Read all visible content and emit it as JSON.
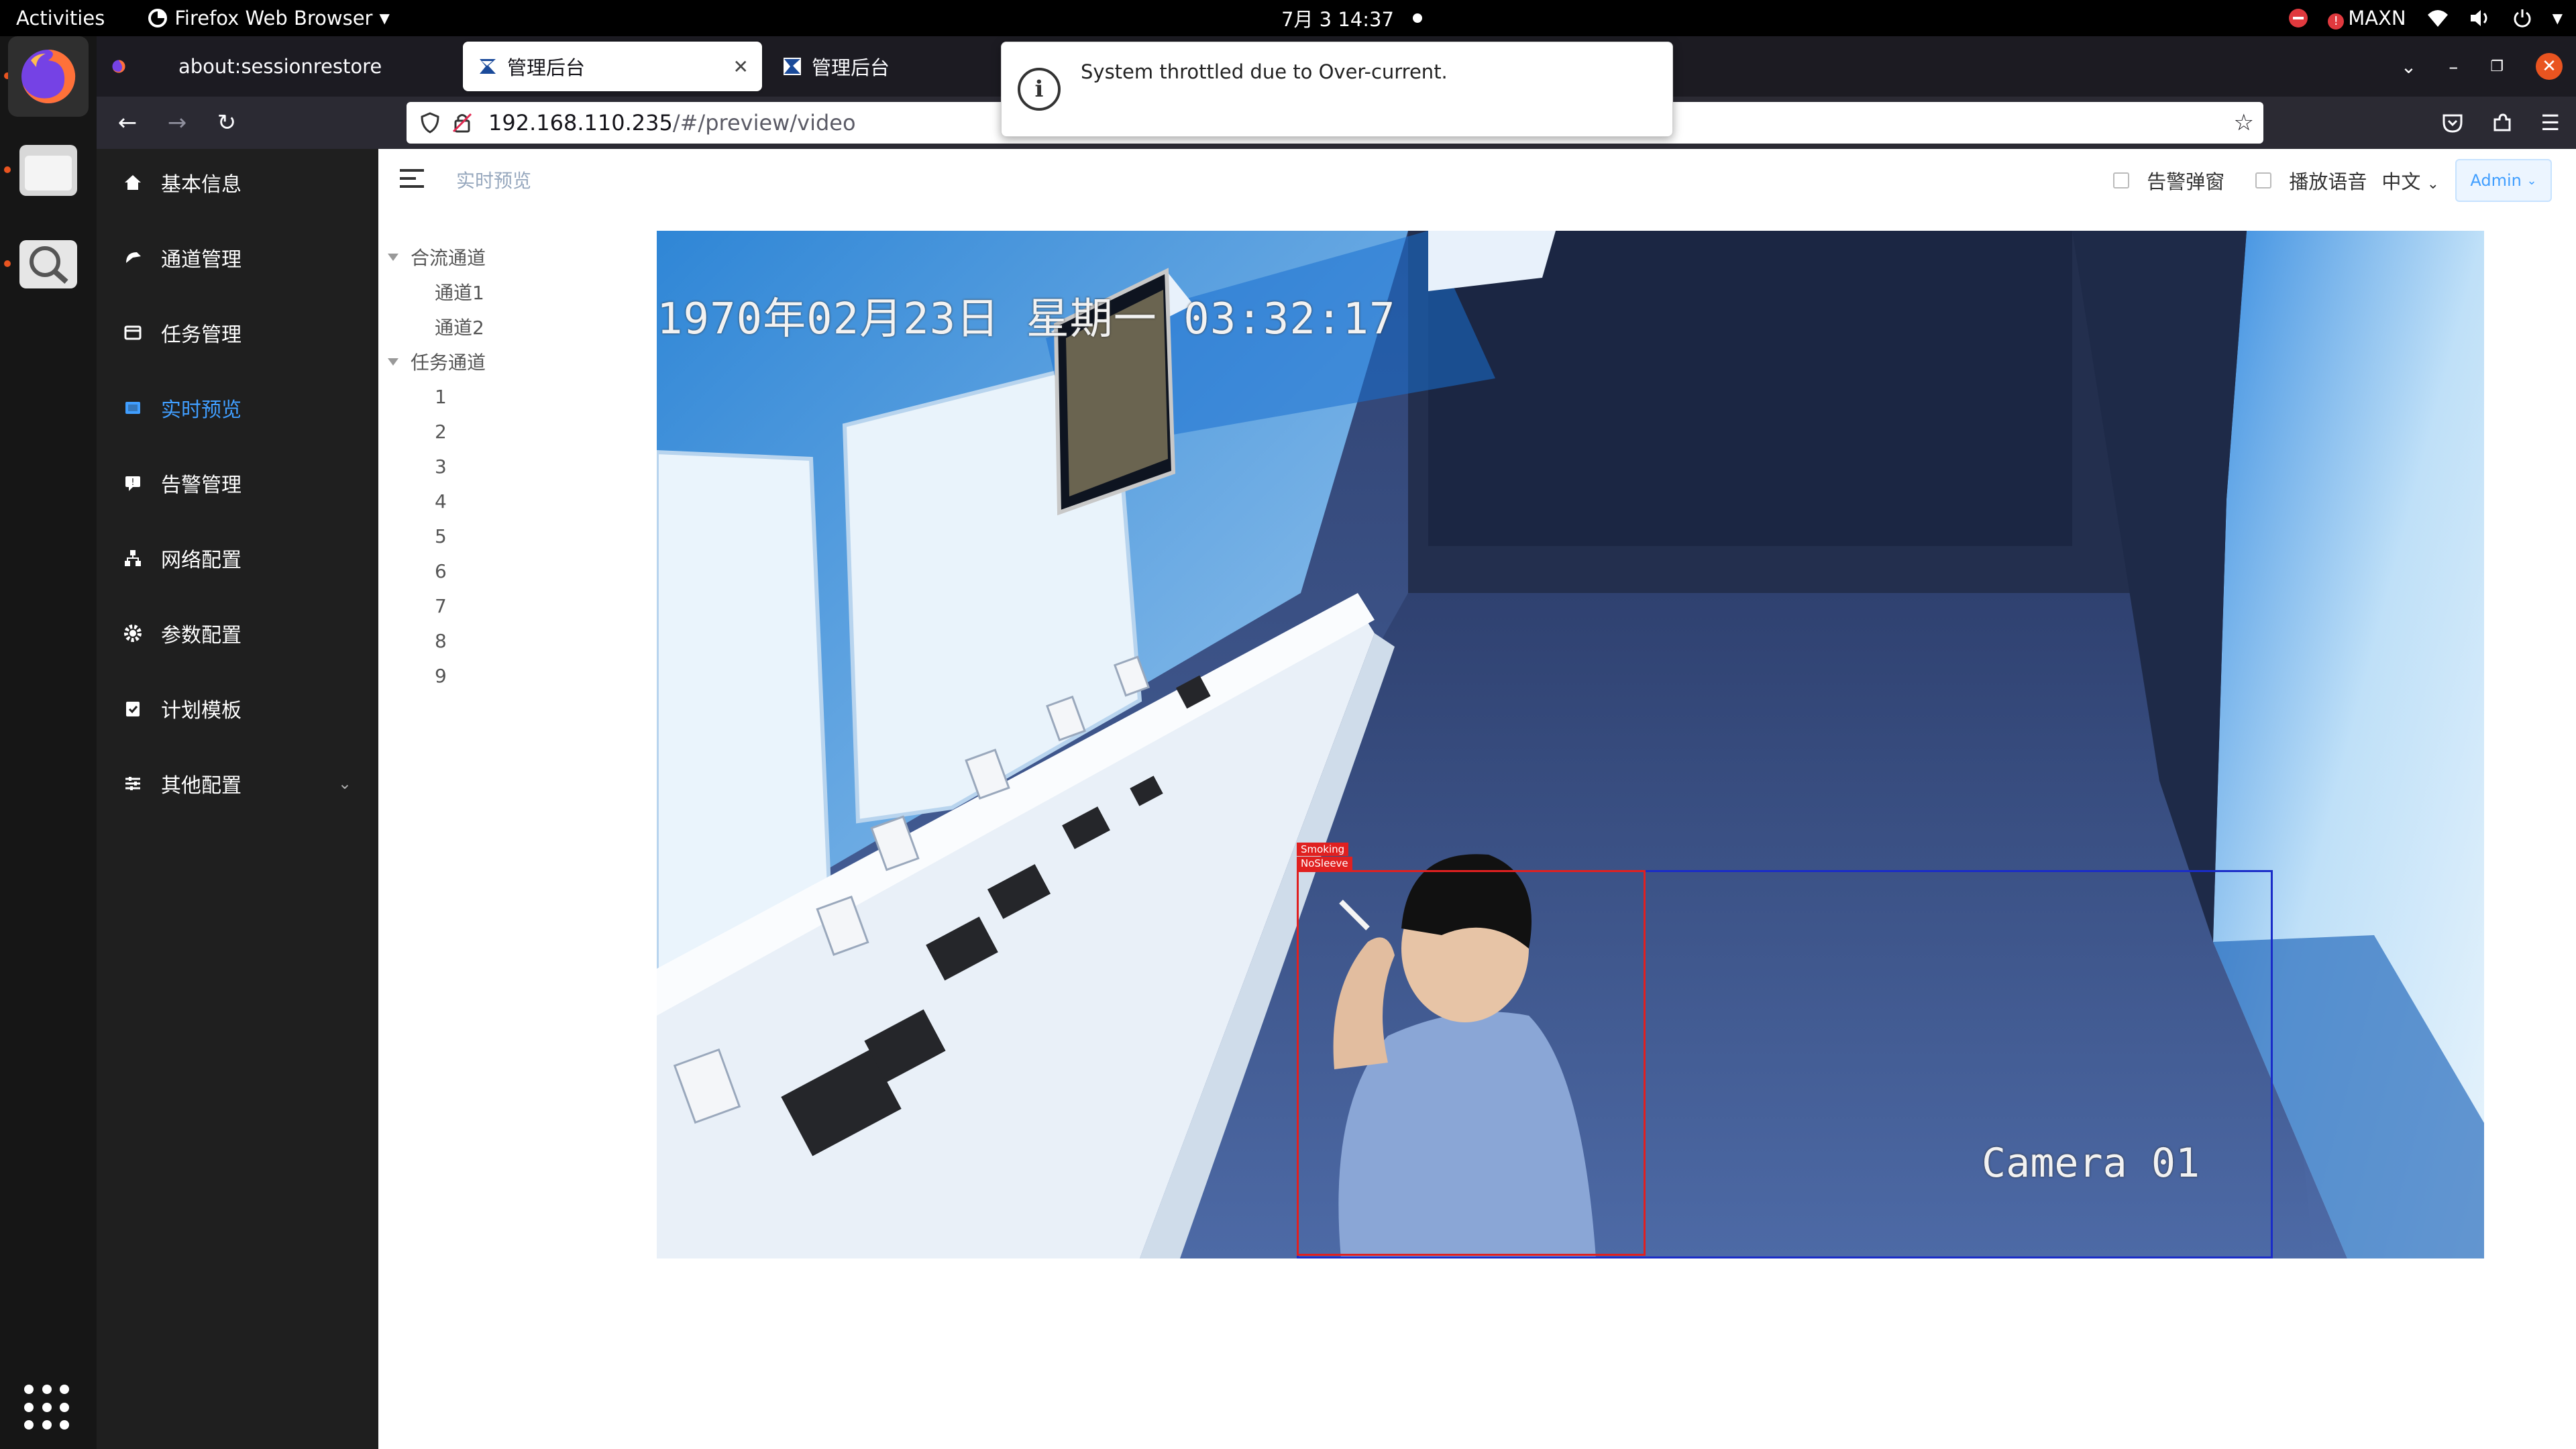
{
  "topbar": {
    "activities": "Activities",
    "app_name": "Firefox Web Browser",
    "clock": "7月 3  14:37",
    "tray_label": "MAXN"
  },
  "tabs": [
    {
      "label": "about:sessionrestore"
    },
    {
      "label": "管理后台"
    },
    {
      "label": "管理后台"
    }
  ],
  "navbar": {
    "url_host": "192.168.110.235",
    "url_path": "/#/preview/video"
  },
  "notification": {
    "text": "System throttled due to Over-current."
  },
  "sidebar": {
    "items": [
      {
        "label": "基本信息",
        "icon": "home-icon"
      },
      {
        "label": "通道管理",
        "icon": "channel-icon"
      },
      {
        "label": "任务管理",
        "icon": "task-icon"
      },
      {
        "label": "实时预览",
        "icon": "preview-icon",
        "active": true
      },
      {
        "label": "告警管理",
        "icon": "alarm-icon"
      },
      {
        "label": "网络配置",
        "icon": "network-icon"
      },
      {
        "label": "参数配置",
        "icon": "settings-icon"
      },
      {
        "label": "计划模板",
        "icon": "plan-icon"
      },
      {
        "label": "其他配置",
        "icon": "sliders-icon"
      }
    ]
  },
  "header": {
    "breadcrumb": "实时预览",
    "alarm_popup_label": "告警弹窗",
    "play_voice_label": "播放语音",
    "language": "中文",
    "user": "Admin"
  },
  "channel_tree": {
    "merged_group": "合流通道",
    "merged_channels": [
      "通道1",
      "通道2"
    ],
    "task_group": "任务通道",
    "task_channels": [
      "1",
      "2",
      "3",
      "4",
      "5",
      "6",
      "7",
      "8",
      "9"
    ]
  },
  "video": {
    "osd_time": "1970年02月23日 星期一 03:32:17",
    "camera_label": "Camera 01",
    "detections": [
      "Smoking",
      "NoSleeve"
    ]
  },
  "colors": {
    "accent": "#409eff",
    "sidebar_bg": "#1f1f1f",
    "firefox_orange": "#e95420"
  }
}
